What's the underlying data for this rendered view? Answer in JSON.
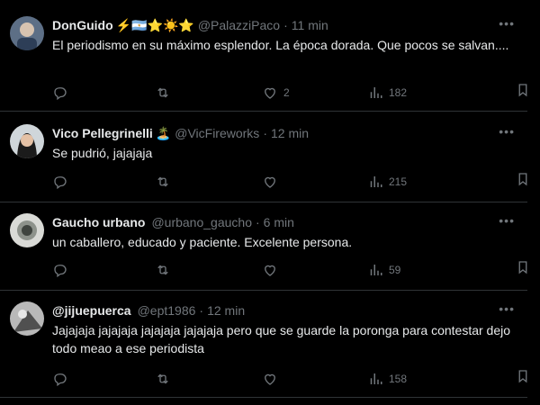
{
  "posts": [
    {
      "name": "DonGuido",
      "badges": "⚡🇦🇷⭐☀️⭐",
      "handle": "@PalazziPaco",
      "time": "11 min",
      "text": "El periodismo en su máximo esplendor. La época dorada. Que pocos se salvan....",
      "reply_count": "",
      "repost_count": "",
      "like_count": "2",
      "view_count": "182"
    },
    {
      "name": "Vico Pellegrinelli",
      "badges": "🏝️",
      "handle": "@VicFireworks",
      "time": "12 min",
      "text": "Se pudrió, jajajaja",
      "reply_count": "",
      "repost_count": "",
      "like_count": "",
      "view_count": "215"
    },
    {
      "name": "Gaucho urbano",
      "badges": "",
      "handle": "@urbano_gaucho",
      "time": "6 min",
      "text": "un caballero, educado y paciente. Excelente persona.",
      "reply_count": "",
      "repost_count": "",
      "like_count": "",
      "view_count": "59"
    },
    {
      "name": "@jijuepuerca",
      "badges": "",
      "handle": "@ept1986",
      "time": "12 min",
      "text": "Jajajaja jajajaja jajajaja jajajaja pero que se guarde la poronga para contestar dejo todo meao a ese periodista",
      "reply_count": "",
      "repost_count": "",
      "like_count": "",
      "view_count": "158"
    }
  ],
  "icons": {
    "reply": "reply-icon",
    "repost": "repost-icon",
    "like": "heart-icon",
    "views": "views-icon",
    "bookmark": "bookmark-icon",
    "share": "share-icon",
    "more": "more-icon"
  },
  "colors": {
    "background": "#000000",
    "text": "#e7e9ea",
    "secondary": "#71767b",
    "divider": "#2f3336"
  }
}
